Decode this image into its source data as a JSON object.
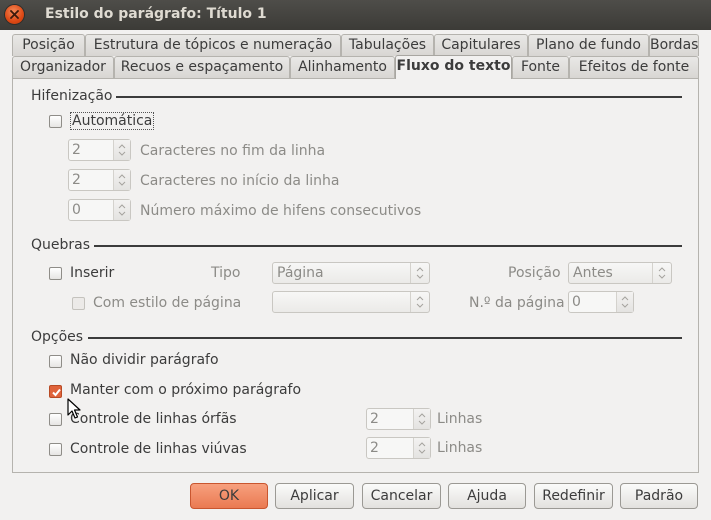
{
  "window": {
    "title": "Estilo do parágrafo: Título 1"
  },
  "tabs_row1": [
    {
      "label": "Posição"
    },
    {
      "label": "Estrutura de tópicos e numeração"
    },
    {
      "label": "Tabulações"
    },
    {
      "label": "Capitulares"
    },
    {
      "label": "Plano de fundo"
    },
    {
      "label": "Bordas"
    }
  ],
  "tabs_row2": [
    {
      "label": "Organizador"
    },
    {
      "label": "Recuos e espaçamento"
    },
    {
      "label": "Alinhamento"
    },
    {
      "label": "Fluxo do texto",
      "active": true
    },
    {
      "label": "Fonte"
    },
    {
      "label": "Efeitos de fonte"
    }
  ],
  "hyphenation": {
    "heading": "Hifenização",
    "automatic_label": "Automática",
    "automatic_checked": false,
    "end_chars_value": "2",
    "end_chars_label": "Caracteres no fim da linha",
    "start_chars_value": "2",
    "start_chars_label": "Caracteres no início da linha",
    "max_consec_value": "0",
    "max_consec_label": "Número máximo de hifens consecutivos"
  },
  "breaks": {
    "heading": "Quebras",
    "insert_label": "Inserir",
    "insert_checked": false,
    "type_label": "Tipo",
    "type_value": "Página",
    "position_label": "Posição",
    "position_value": "Antes",
    "page_style_label": "Com estilo de página",
    "page_style_value": "",
    "page_number_label": "N.º da página",
    "page_number_value": "0"
  },
  "options": {
    "heading": "Opções",
    "dont_split_label": "Não dividir parágrafo",
    "dont_split_checked": false,
    "keep_next_label": "Manter com o próximo parágrafo",
    "keep_next_checked": true,
    "orphan_label": "Controle de linhas órfãs",
    "orphan_checked": false,
    "orphan_value": "2",
    "orphan_unit": "Linhas",
    "widow_label": "Controle de linhas viúvas",
    "widow_checked": false,
    "widow_value": "2",
    "widow_unit": "Linhas"
  },
  "buttons": {
    "ok": "OK",
    "apply": "Aplicar",
    "cancel": "Cancelar",
    "help": "Ajuda",
    "reset": "Redefinir",
    "standard": "Padrão"
  },
  "colors": {
    "accent": "#e0633b",
    "titlebar": "#3c3b37",
    "background": "#f2f1f0"
  }
}
